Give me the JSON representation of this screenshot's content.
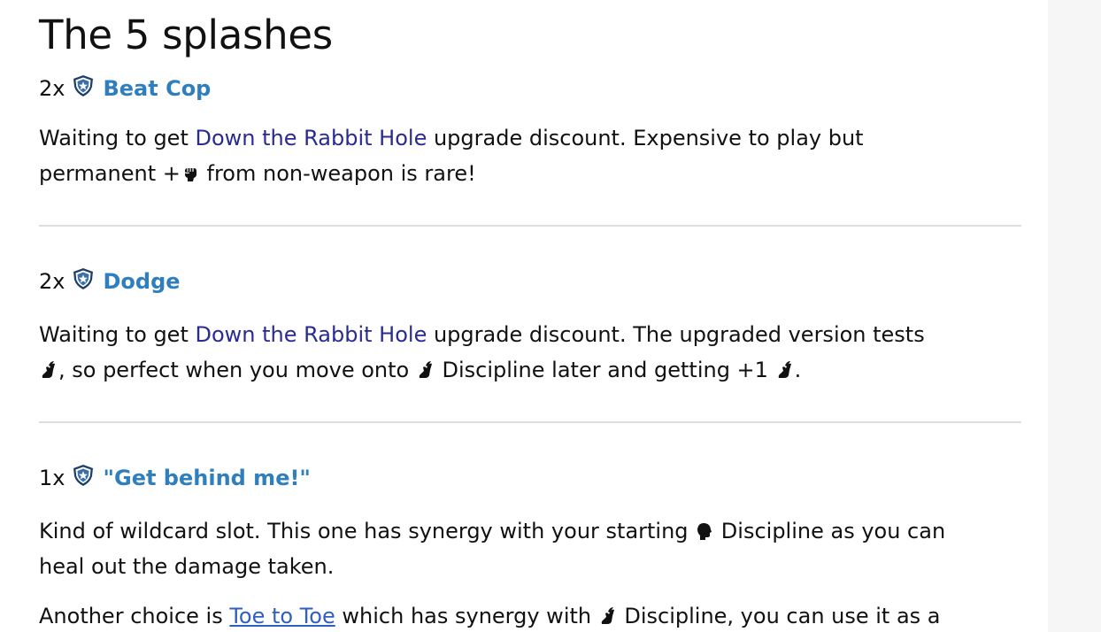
{
  "page": {
    "title": "The 5 splashes"
  },
  "sections": [
    {
      "qty": "2x",
      "card": "Beat Cop",
      "text_before": "Waiting to get ",
      "link": "Down the Rabbit Hole",
      "text_after": " upgrade discount. Expensive to play but",
      "line2_before": "permanent +",
      "line2_after": " from non-weapon is rare!"
    },
    {
      "qty": "2x",
      "card": "Dodge",
      "text_before": "Waiting to get ",
      "link": "Down the Rabbit Hole",
      "text_after": " upgrade discount. The upgraded version tests",
      "line2_a": ", so perfect when you move onto ",
      "line2_b": " Discipline later and getting +1 ",
      "line2_c": "."
    },
    {
      "qty": "1x",
      "card": "\"Get behind me!\"",
      "line1_before": "Kind of wildcard slot. This one has synergy with your starting ",
      "line1_after": " Discipline as you can",
      "line2": "heal out the damage taken.",
      "p2_before": "Another choice is ",
      "p2_link": "Toe to Toe",
      "p2_mid": " which has synergy with ",
      "p2_after": " Discipline, you can use it as a"
    }
  ],
  "icons": {
    "faction": "guardian-shield-icon",
    "combat": "fist-icon",
    "agility": "winged-boot-icon",
    "willpower": "head-icon"
  },
  "colors": {
    "card_name": "#2f7fbf",
    "inline_link": "#2a2a93",
    "faction_icon": "#1f3f6a"
  }
}
